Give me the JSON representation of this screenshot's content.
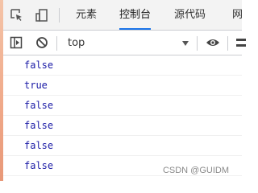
{
  "tabs": [
    {
      "label": "元素"
    },
    {
      "label": "控制台"
    },
    {
      "label": "源代码"
    },
    {
      "label": "网"
    }
  ],
  "toolbar": {
    "context": "top"
  },
  "console": {
    "rows": [
      "false",
      "true",
      "false",
      "false",
      "false",
      "false"
    ]
  },
  "watermark": "CSDN @GUIDM",
  "icons": {
    "inspect": "inspect-element-icon",
    "device": "device-toolbar-icon",
    "sidebar": "sidebar-toggle-icon",
    "clear": "clear-console-icon",
    "eye": "live-expression-eye-icon",
    "settings": "settings-icon"
  },
  "colors": {
    "active_tab_underline": "#1a73e8",
    "log_text": "#1a1aa6"
  }
}
